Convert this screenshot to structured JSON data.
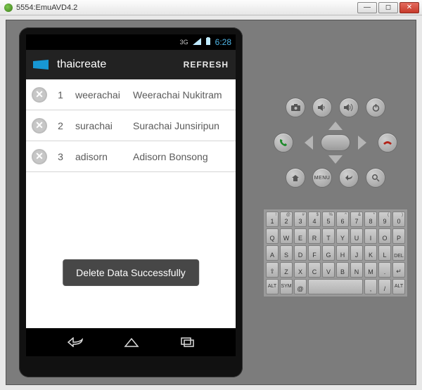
{
  "window": {
    "title": "5554:EmuAVD4.2"
  },
  "status": {
    "net": "3G",
    "time": "6:28"
  },
  "actionbar": {
    "title": "thaicreate",
    "refresh": "REFRESH"
  },
  "rows": [
    {
      "id": "1",
      "user": "weerachai",
      "full": "Weerachai Nukitram"
    },
    {
      "id": "2",
      "user": "surachai",
      "full": "Surachai Junsiripun"
    },
    {
      "id": "3",
      "user": "adisorn",
      "full": "Adisorn Bonsong"
    }
  ],
  "toast": "Delete Data Successfully",
  "panel": {
    "menu": "MENU"
  },
  "keyboard": {
    "r1": [
      {
        "m": "1",
        "s": "!"
      },
      {
        "m": "2",
        "s": "@"
      },
      {
        "m": "3",
        "s": "#"
      },
      {
        "m": "4",
        "s": "$"
      },
      {
        "m": "5",
        "s": "%"
      },
      {
        "m": "6",
        "s": "^"
      },
      {
        "m": "7",
        "s": "&"
      },
      {
        "m": "8",
        "s": "*"
      },
      {
        "m": "9",
        "s": "("
      },
      {
        "m": "0",
        "s": ")"
      }
    ],
    "r2": [
      {
        "m": "Q"
      },
      {
        "m": "W"
      },
      {
        "m": "E"
      },
      {
        "m": "R"
      },
      {
        "m": "T"
      },
      {
        "m": "Y"
      },
      {
        "m": "U"
      },
      {
        "m": "I"
      },
      {
        "m": "O"
      },
      {
        "m": "P"
      }
    ],
    "r3": [
      {
        "m": "A"
      },
      {
        "m": "S"
      },
      {
        "m": "D"
      },
      {
        "m": "F"
      },
      {
        "m": "G"
      },
      {
        "m": "H"
      },
      {
        "m": "J"
      },
      {
        "m": "K"
      },
      {
        "m": "L"
      }
    ],
    "r3_del": "DEL",
    "r4_shift": "⇧",
    "r4": [
      {
        "m": "Z"
      },
      {
        "m": "X"
      },
      {
        "m": "C"
      },
      {
        "m": "V"
      },
      {
        "m": "B"
      },
      {
        "m": "N"
      },
      {
        "m": "M"
      },
      {
        "m": "."
      }
    ],
    "r4_enter": "↵",
    "r5": {
      "alt1": "ALT",
      "sym": "SYM",
      "at": "@",
      "comma": ",",
      "slash": "/",
      "alt2": "ALT"
    }
  }
}
